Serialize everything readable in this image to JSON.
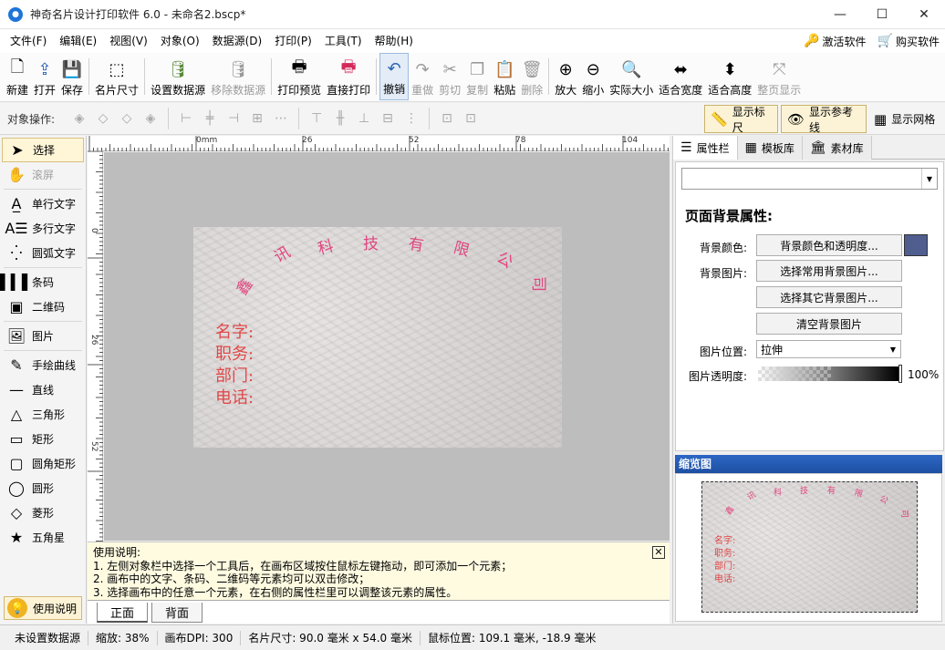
{
  "window": {
    "title": "神奇名片设计打印软件 6.0 - 未命名2.bscp*"
  },
  "menu": {
    "items": [
      "文件(F)",
      "编辑(E)",
      "视图(V)",
      "对象(O)",
      "数据源(D)",
      "打印(P)",
      "工具(T)",
      "帮助(H)"
    ],
    "activate": "激活软件",
    "buy": "购买软件"
  },
  "toolbar": {
    "new": "新建",
    "open": "打开",
    "save": "保存",
    "card_size": "名片尺寸",
    "set_datasource": "设置数据源",
    "remove_datasource": "移除数据源",
    "print_preview": "打印预览",
    "direct_print": "直接打印",
    "undo": "撤销",
    "redo": "重做",
    "cut": "剪切",
    "copy": "复制",
    "paste": "粘贴",
    "delete": "删除",
    "zoom_in": "放大",
    "zoom_out": "缩小",
    "actual_size": "实际大小",
    "fit_width": "适合宽度",
    "fit_height": "适合高度",
    "fit_page": "整页显示"
  },
  "opsbar": {
    "label": "对象操作:",
    "show_ruler": "显示标尺",
    "show_guides": "显示参考线",
    "show_grid": "显示网格"
  },
  "tools": {
    "select": "选择",
    "scroll": "滚屏",
    "single_text": "单行文字",
    "multi_text": "多行文字",
    "arc_text": "圆弧文字",
    "barcode": "条码",
    "qrcode": "二维码",
    "image": "图片",
    "freehand": "手绘曲线",
    "line": "直线",
    "triangle": "三角形",
    "rect": "矩形",
    "round_rect": "圆角矩形",
    "ellipse": "圆形",
    "diamond": "菱形",
    "star": "五角星",
    "help": "使用说明"
  },
  "ruler": {
    "top": [
      "0mm",
      "26",
      "52",
      "78",
      "104"
    ],
    "left": [
      "0",
      "26",
      "52"
    ]
  },
  "card": {
    "arc_chars": [
      "鑫",
      "讯",
      "科",
      "技",
      "有",
      "限",
      "公",
      "司"
    ],
    "lines": [
      "名字:",
      "职务:",
      "部门:",
      "电话:"
    ]
  },
  "help_box": {
    "title": "使用说明:",
    "lines": [
      "1. 左侧对象栏中选择一个工具后，在画布区域按住鼠标左键拖动，即可添加一个元素；",
      "2. 画布中的文字、条码、二维码等元素均可以双击修改；",
      "3. 选择画布中的任意一个元素，在右侧的属性栏里可以调整该元素的属性。"
    ]
  },
  "page_tabs": [
    "正面",
    "背面"
  ],
  "right_panel": {
    "tabs": [
      "属性栏",
      "模板库",
      "素材库"
    ],
    "combo_value": "",
    "section_title": "页面背景属性:",
    "bg_color_label": "背景颜色:",
    "bg_color_button": "背景颜色和透明度...",
    "bg_color_value": "#4f5d8f",
    "bg_image_label": "背景图片:",
    "btn_common_bg": "选择常用背景图片...",
    "btn_other_bg": "选择其它背景图片...",
    "btn_clear_bg": "清空背景图片",
    "image_pos_label": "图片位置:",
    "image_pos_value": "拉伸",
    "opacity_label": "图片透明度:",
    "opacity_value": "100%",
    "thumb_header": "缩览图"
  },
  "status": {
    "datasource": "未设置数据源",
    "zoom": "缩放: 38%",
    "dpi": "画布DPI: 300",
    "card_size": "名片尺寸: 90.0 毫米 x 54.0 毫米",
    "mouse": "鼠标位置: 109.1 毫米, -18.9 毫米"
  }
}
